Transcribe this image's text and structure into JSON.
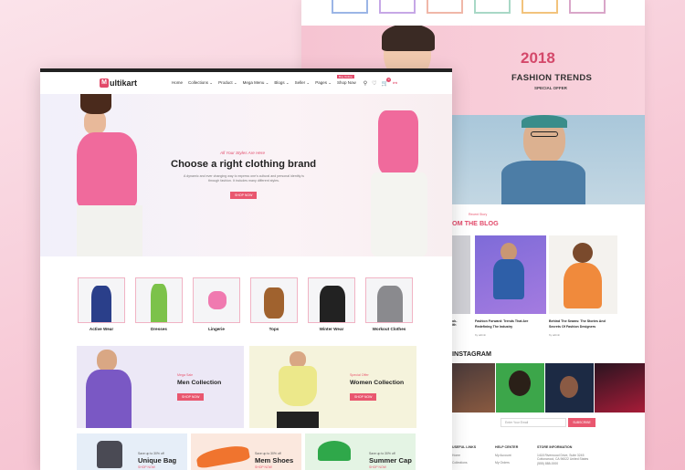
{
  "back_panel": {
    "trends_year": "2018",
    "trends_title": "FASHION TRENDS",
    "trends_subtitle": "SPECIAL OFFER",
    "blog_kicker": "Recent Story",
    "blog_title": "OM THE BLOG",
    "blog_posts": [
      {
        "title": "ok-",
        "line2": "ith",
        "meta": ""
      },
      {
        "title": "Fashion Forward: Trends That Are",
        "line2": "Redefining The Industry",
        "meta": "by admin"
      },
      {
        "title": "Behind The Seams: The Stories And",
        "line2": "Secrets Of Fashion Designers",
        "meta": "by admin"
      }
    ],
    "instagram_title": "INSTAGRAM",
    "newsletter_placeholder": "Enter Your Email",
    "subscribe_label": "SUBSCRIBE",
    "footer_cols": [
      {
        "title": "USEFUL LINKS",
        "items": [
          "Home",
          "Collections"
        ]
      },
      {
        "title": "HELP CENTER",
        "items": [
          "My Account",
          "My Orders"
        ]
      },
      {
        "title": "STORE INFORMATION",
        "items": [
          "1418 Riverwood Drive, Suite 3245 Cottonwood, CA 96022 United States",
          "(555) 888-0000"
        ]
      }
    ]
  },
  "nav": {
    "logo_initial": "M",
    "logo_text": "ultikart",
    "menu": [
      "Home",
      "Collections ⌄",
      "Product ⌄",
      "Mega Menu ⌄",
      "Blogs ⌄",
      "Seller ⌄",
      "Pages ⌄"
    ],
    "shop_now": "Shop Now",
    "shop_badge": "Buy Online",
    "cart_count": "0",
    "icons": [
      "search-icon",
      "heart-icon",
      "cart-icon",
      "user-icon"
    ]
  },
  "hero": {
    "tagline": "All Your Styles Are Here",
    "title": "Choose a right clothing brand",
    "desc_line1": "A dynamic and ever changing way to express one's cultural and personal identity is",
    "desc_line2": "through fashion. It includes many different styles.",
    "cta": "SHOP NOW"
  },
  "categories": [
    "Active Wear",
    "Dresses",
    "Lingerie",
    "Tops",
    "Winter Wear",
    "Workout Clothes"
  ],
  "promo_banners": [
    {
      "kicker": "Mega Sale",
      "title": "Men Collection",
      "cta": "SHOP NOW"
    },
    {
      "kicker": "Special Offer",
      "title": "Women Collection",
      "cta": "SHOP NOW"
    }
  ],
  "small_banners": [
    {
      "kicker": "Save up to 30% off",
      "title": "Unique Bag",
      "cta": "SHOP NOW"
    },
    {
      "kicker": "Save up to 30% off",
      "title": "Mem Shoes",
      "cta": "SHOP NOW"
    },
    {
      "kicker": "Save up to 30% off",
      "title": "Summer Cap",
      "cta": "SHOP NOW"
    }
  ],
  "colors": {
    "accent": "#e9576f",
    "brand_pink": "#e24a6a",
    "trend_pink": "#d4486a"
  }
}
